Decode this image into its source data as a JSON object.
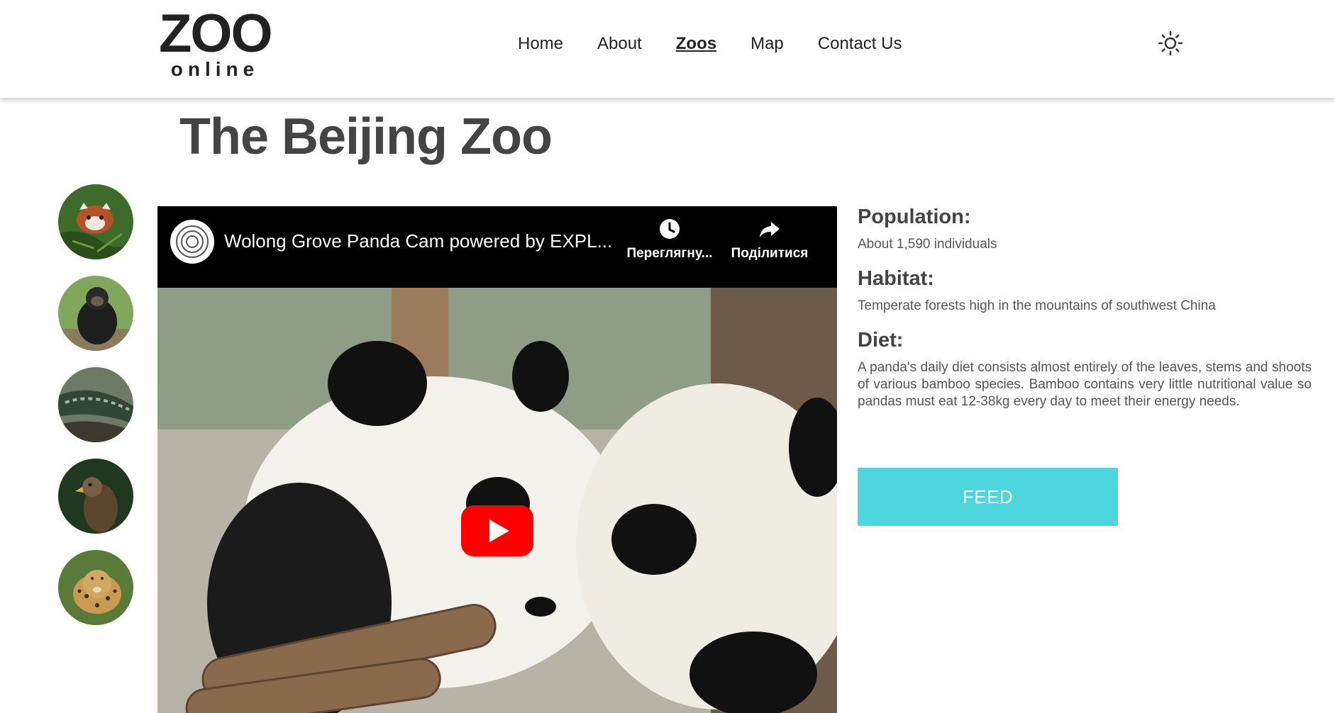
{
  "logo": {
    "main": "ZOO",
    "sub": "online"
  },
  "nav": {
    "items": [
      {
        "label": "Home",
        "active": false
      },
      {
        "label": "About",
        "active": false
      },
      {
        "label": "Zoos",
        "active": true
      },
      {
        "label": "Map",
        "active": false
      },
      {
        "label": "Contact Us",
        "active": false
      }
    ]
  },
  "theme_toggle_icon": "sun-icon",
  "page": {
    "title": "The Beijing Zoo"
  },
  "animals": [
    {
      "name": "red-panda",
      "icon": "red-panda-avatar"
    },
    {
      "name": "chimpanzee",
      "icon": "chimpanzee-avatar"
    },
    {
      "name": "crocodile",
      "icon": "crocodile-avatar"
    },
    {
      "name": "eagle",
      "icon": "eagle-avatar"
    },
    {
      "name": "jaguar",
      "icon": "jaguar-avatar"
    }
  ],
  "video": {
    "title": "Wolong Grove Panda Cam powered by EXPL...",
    "watch_later_label": "Переглягну...",
    "share_label": "Поділитися"
  },
  "info": {
    "population_heading": "Population:",
    "population_text": "About 1,590 individuals",
    "habitat_heading": "Habitat:",
    "habitat_text": "Temperate forests high in the mountains of southwest China",
    "diet_heading": "Diet:",
    "diet_text": "A panda's daily diet consists almost entirely of the leaves, stems and shoots of various bamboo species. Bamboo contains very little nutritional value so pandas must eat 12-38kg every day to meet their energy needs."
  },
  "feed_button": {
    "label": "FEED",
    "color": "#4dd6de"
  }
}
